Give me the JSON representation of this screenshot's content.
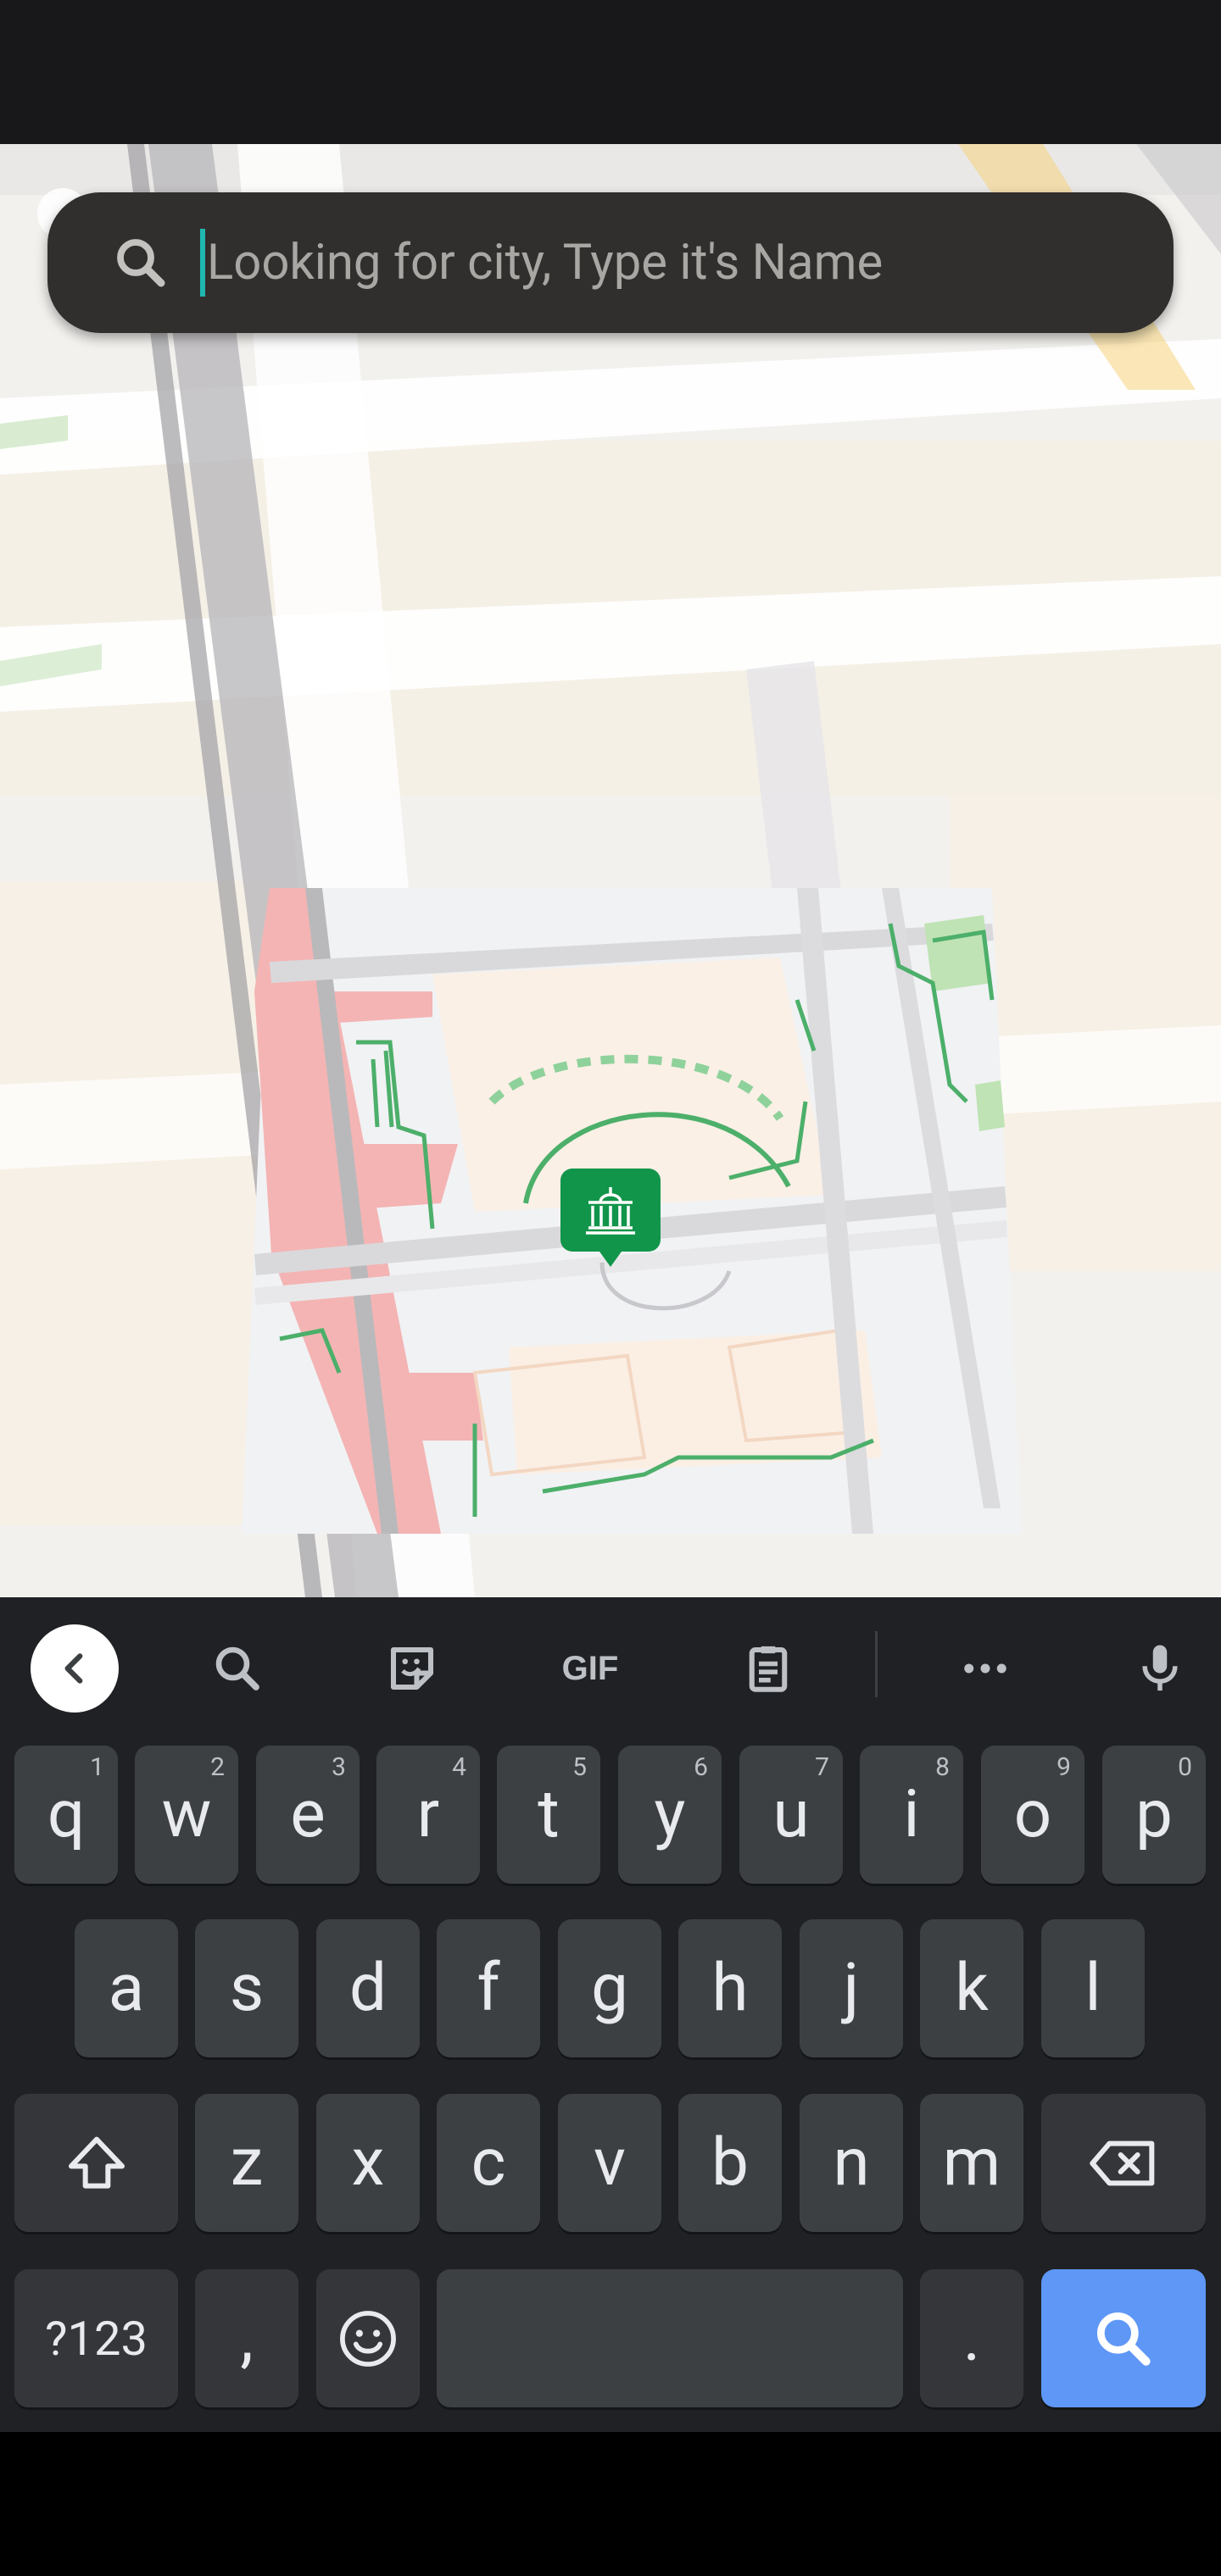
{
  "search": {
    "placeholder": "Looking for city, Type it's Name",
    "value": ""
  },
  "map": {
    "landmark_icon": "museum-icon",
    "pin_color": "#11954a"
  },
  "keyboard": {
    "toolbar": {
      "items": [
        "chevron-left-icon",
        "search-icon",
        "sticker-icon",
        "GIF",
        "clipboard-icon",
        "more-icon",
        "mic-icon"
      ]
    },
    "row1": [
      {
        "label": "q",
        "hint": "1"
      },
      {
        "label": "w",
        "hint": "2"
      },
      {
        "label": "e",
        "hint": "3"
      },
      {
        "label": "r",
        "hint": "4"
      },
      {
        "label": "t",
        "hint": "5"
      },
      {
        "label": "y",
        "hint": "6"
      },
      {
        "label": "u",
        "hint": "7"
      },
      {
        "label": "i",
        "hint": "8"
      },
      {
        "label": "o",
        "hint": "9"
      },
      {
        "label": "p",
        "hint": "0"
      }
    ],
    "row2": [
      "a",
      "s",
      "d",
      "f",
      "g",
      "h",
      "j",
      "k",
      "l"
    ],
    "row3": [
      "z",
      "x",
      "c",
      "v",
      "b",
      "n",
      "m"
    ],
    "row4": {
      "symbols": "?123",
      "comma": ",",
      "period": "."
    },
    "colors": {
      "key": "#3c4043",
      "action": "#5e97f6",
      "background": "#202124"
    }
  }
}
